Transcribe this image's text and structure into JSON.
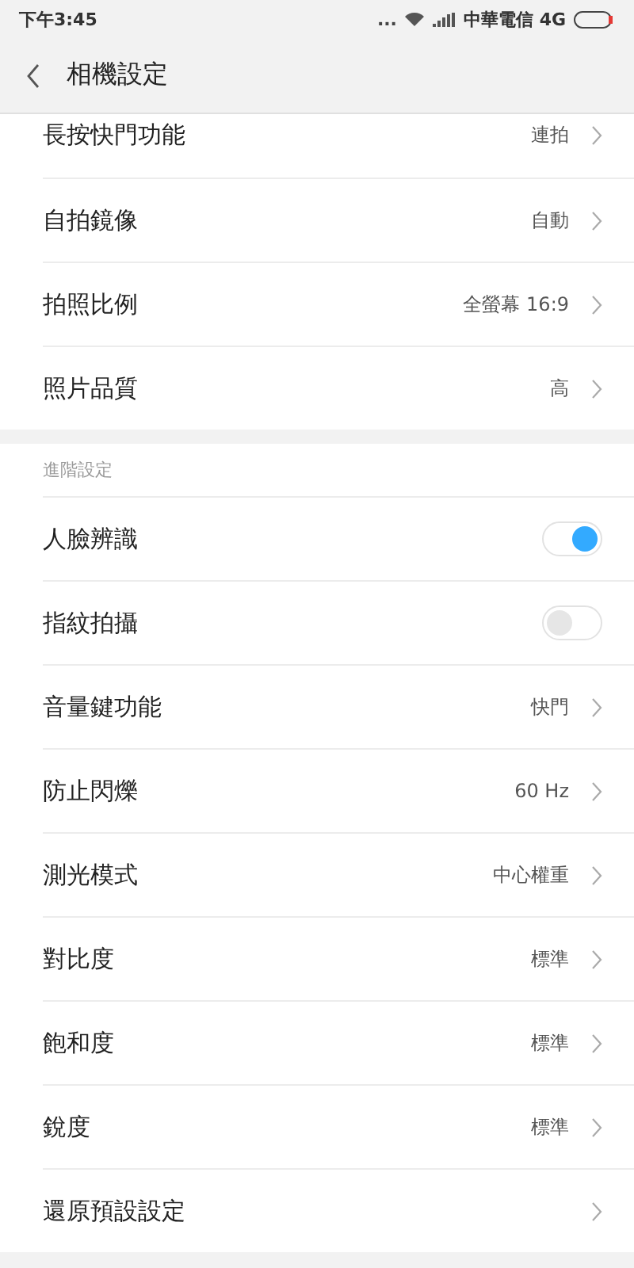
{
  "status_bar": {
    "time": "下午3:45",
    "dots": "...",
    "carrier": "中華電信 4G"
  },
  "header": {
    "title": "相機設定"
  },
  "groups": [
    {
      "rows": [
        {
          "kind": "value",
          "label": "長按快門功能",
          "value": "連拍"
        },
        {
          "kind": "value",
          "label": "自拍鏡像",
          "value": "自動"
        },
        {
          "kind": "value",
          "label": "拍照比例",
          "value": "全螢幕 16:9"
        },
        {
          "kind": "value",
          "label": "照片品質",
          "value": "高"
        }
      ]
    },
    {
      "title": "進階設定",
      "rows": [
        {
          "kind": "toggle",
          "label": "人臉辨識",
          "on": true
        },
        {
          "kind": "toggle",
          "label": "指紋拍攝",
          "on": false
        },
        {
          "kind": "value",
          "label": "音量鍵功能",
          "value": "快門"
        },
        {
          "kind": "value",
          "label": "防止閃爍",
          "value": "60 Hz"
        },
        {
          "kind": "value",
          "label": "測光模式",
          "value": "中心權重"
        },
        {
          "kind": "value",
          "label": "對比度",
          "value": "標準"
        },
        {
          "kind": "value",
          "label": "飽和度",
          "value": "標準"
        },
        {
          "kind": "value",
          "label": "銳度",
          "value": "標準"
        },
        {
          "kind": "link",
          "label": "還原預設設定"
        }
      ]
    }
  ]
}
